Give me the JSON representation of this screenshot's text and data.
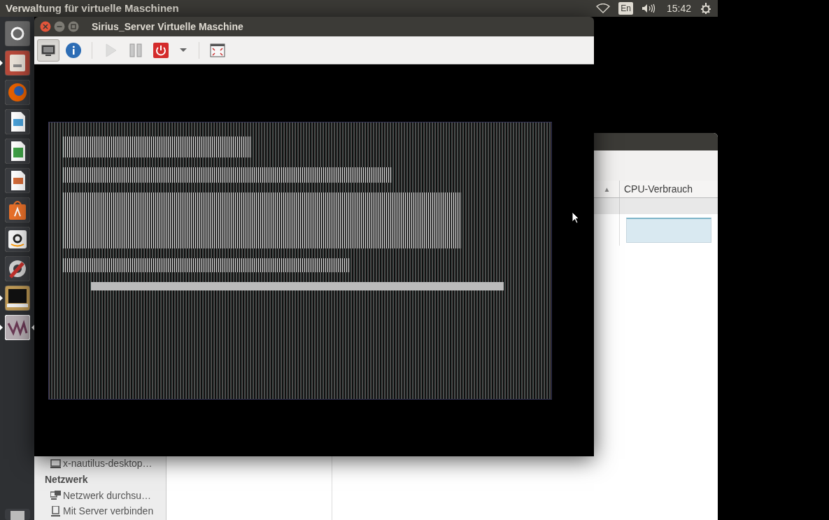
{
  "top_bar": {
    "title": "Verwaltung für virtuelle Maschinen",
    "keyboard_layout": "En",
    "time": "15:42"
  },
  "launcher": [
    {
      "kind": "dash",
      "running": false,
      "selected": false
    },
    {
      "kind": "files",
      "running": true,
      "selected": false
    },
    {
      "kind": "browser",
      "running": false,
      "selected": false
    },
    {
      "kind": "writer",
      "running": false,
      "selected": false
    },
    {
      "kind": "calc",
      "running": false,
      "selected": false
    },
    {
      "kind": "impress",
      "running": false,
      "selected": false
    },
    {
      "kind": "store",
      "running": false,
      "selected": false
    },
    {
      "kind": "shop",
      "running": false,
      "selected": false
    },
    {
      "kind": "settings",
      "running": false,
      "selected": false
    },
    {
      "kind": "terminal",
      "running": true,
      "selected": false
    },
    {
      "kind": "vm",
      "running": true,
      "selected": true
    }
  ],
  "back_window": {
    "column_header": {
      "sort_indicator": "▲",
      "label": "CPU-Verbrauch"
    },
    "sidebar": [
      {
        "kind": "desktop",
        "label": "x-nautilus-desktop…"
      },
      {
        "kind": "section",
        "label": "Netzwerk"
      },
      {
        "kind": "network",
        "label": "Netzwerk durchsu…"
      },
      {
        "kind": "server",
        "label": "Mit Server verbinden"
      }
    ]
  },
  "vm_window": {
    "title": "Sirius_Server Virtuelle Maschine",
    "toolbar": [
      {
        "kind": "console",
        "selected": true,
        "disabled": false
      },
      {
        "kind": "details",
        "selected": false,
        "disabled": false
      },
      {
        "kind": "separator"
      },
      {
        "kind": "run",
        "selected": false,
        "disabled": true
      },
      {
        "kind": "pause",
        "selected": false,
        "disabled": false
      },
      {
        "kind": "shutdown",
        "selected": false,
        "disabled": false
      },
      {
        "kind": "menu",
        "selected": false,
        "disabled": false
      },
      {
        "kind": "separator"
      },
      {
        "kind": "fullscreen",
        "selected": false,
        "disabled": false
      }
    ]
  }
}
